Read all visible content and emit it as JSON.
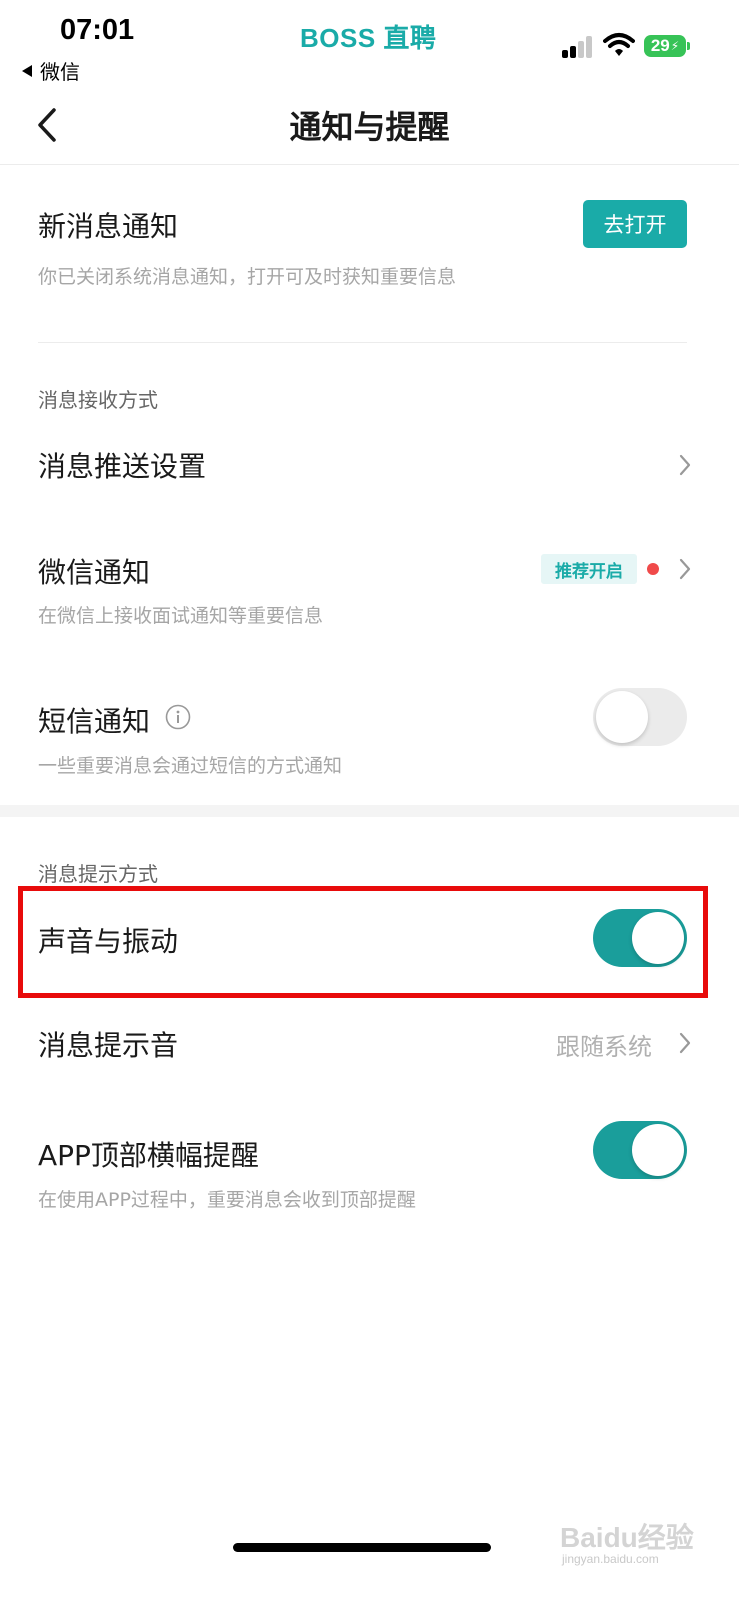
{
  "status_bar": {
    "time": "07:01",
    "back_app": "微信",
    "brand": "BOSS 直聘",
    "battery": "29"
  },
  "nav": {
    "title": "通知与提醒"
  },
  "new_message": {
    "title": "新消息通知",
    "subtitle": "你已关闭系统消息通知，打开可及时获知重要信息",
    "button": "去打开"
  },
  "receive_section": {
    "label": "消息接收方式",
    "push_settings": {
      "title": "消息推送设置"
    },
    "wechat_notify": {
      "title": "微信通知",
      "subtitle": "在微信上接收面试通知等重要信息",
      "badge": "推荐开启"
    },
    "sms_notify": {
      "title": "短信通知",
      "subtitle": "一些重要消息会通过短信的方式通知",
      "enabled": false
    }
  },
  "alert_section": {
    "label": "消息提示方式",
    "sound_vibration": {
      "title": "声音与振动",
      "enabled": true
    },
    "alert_tone": {
      "title": "消息提示音",
      "value": "跟随系统"
    },
    "banner": {
      "title": "APP顶部横幅提醒",
      "subtitle": "在使用APP过程中，重要消息会收到顶部提醒",
      "enabled": true
    }
  },
  "watermark": {
    "text": "Baidu经验",
    "url": "jingyan.baidu.com"
  },
  "colors": {
    "accent": "#1aaba8",
    "toggle_on": "#1a9e9b",
    "highlight": "#e80b0b",
    "red_dot": "#f04a4a"
  }
}
